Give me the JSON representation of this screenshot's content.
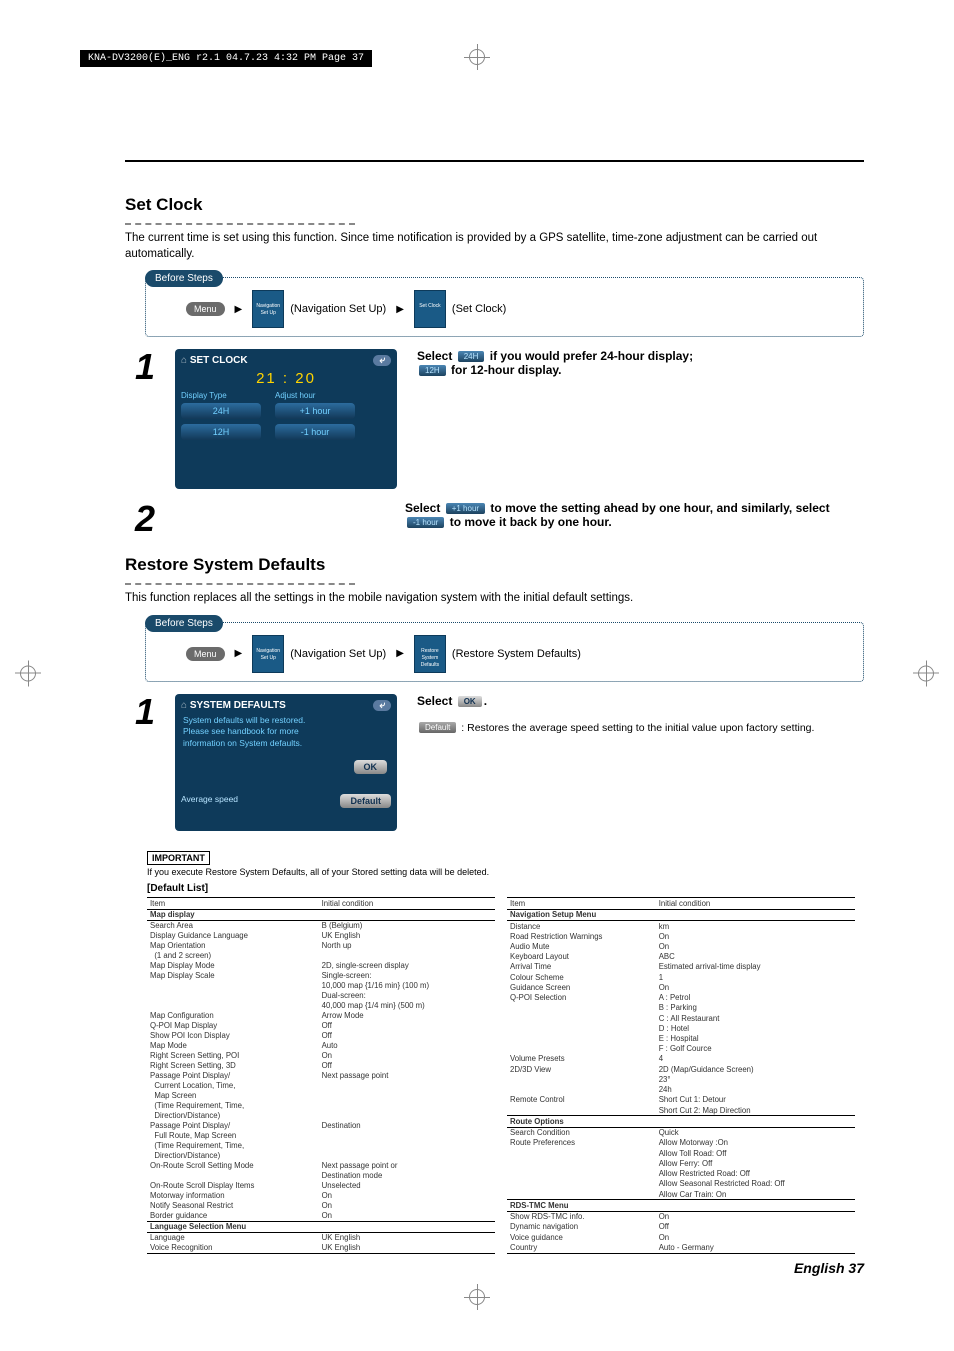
{
  "print": {
    "header": "KNA-DV3200(E)_ENG r2.1  04.7.23  4:32 PM  Page 37"
  },
  "section1": {
    "title": "Set Clock",
    "desc": "The current time is set using this function. Since time notification is provided by a GPS satellite, time-zone adjustment can be carried out automatically.",
    "before_steps": "Before Steps",
    "crumb_menu": "Menu",
    "crumb_nav": "(Navigation Set Up)",
    "crumb_setclock": "(Set Clock)",
    "nav_tile": "Navigation Set Up",
    "setclock_tile": "Set Clock",
    "screen": {
      "title": "SET CLOCK",
      "time": "21 : 20",
      "col1_label": "Display Type",
      "col2_label": "Adjust hour",
      "btn_24h": "24H",
      "btn_12h": "12H",
      "btn_plus": "+1 hour",
      "btn_minus": "-1 hour"
    },
    "step1": {
      "pre": "Select",
      "mid": "if you would prefer 24-hour display;",
      "post": "for 12-hour display.",
      "btn24": "24H",
      "btn12": "12H"
    },
    "step2": {
      "pre": "Select",
      "mid": "to move the setting ahead by one hour, and similarly, select",
      "post": "to move it back by one hour.",
      "btn_plus": "+1 hour",
      "btn_minus": "-1 hour"
    }
  },
  "section2": {
    "title": "Restore System Defaults",
    "desc": "This function replaces all the settings in the mobile navigation system with the initial default settings.",
    "before_steps": "Before Steps",
    "crumb_menu": "Menu",
    "crumb_nav": "(Navigation Set Up)",
    "crumb_rsd": "(Restore System Defaults)",
    "nav_tile": "Navigation Set Up",
    "rsd_tile": "Restore System Defaults",
    "screen": {
      "title": "SYSTEM DEFAULTS",
      "body1": "System defaults will be restored.",
      "body2": "Please see handbook for more",
      "body3": "information on System defaults.",
      "ok": "OK",
      "avg": "Average speed",
      "default": "Default"
    },
    "step": {
      "select": "Select",
      "ok": "OK",
      "default_label": "Default",
      "default_desc": ": Restores the average speed setting to the initial value upon factory setting."
    },
    "important_label": "IMPORTANT",
    "important_text": "If you execute Restore System Defaults, all of your Stored setting data will be deleted.",
    "deflist_header": "[Default List]",
    "tbl_item": "Item",
    "tbl_initial": "Initial condition",
    "tableA": {
      "sec1": "Map display",
      "rows1": [
        [
          "Search Area",
          "B (Belgium)"
        ],
        [
          "Display Guidance Language",
          "UK English"
        ],
        [
          "Map Orientation",
          "North up"
        ],
        [
          "  (1 and 2 screen)",
          ""
        ],
        [
          "Map Display Mode",
          "2D, single-screen display"
        ],
        [
          "Map Display Scale",
          "Single-screen:"
        ],
        [
          "",
          "10,000 map {1/16 min} (100 m)"
        ],
        [
          "",
          "Dual-screen:"
        ],
        [
          "",
          "40,000 map {1/4 min} (500 m)"
        ],
        [
          "Map Configuration",
          "Arrow Mode"
        ],
        [
          "Q-POI Map Display",
          "Off"
        ],
        [
          "Show POI Icon Display",
          "Off"
        ],
        [
          "Map Mode",
          "Auto"
        ],
        [
          "Right Screen Setting, POI",
          "On"
        ],
        [
          "Right Screen Setting, 3D",
          "Off"
        ],
        [
          "Passage Point Display/",
          "Next passage point"
        ],
        [
          "  Current Location, Time,",
          ""
        ],
        [
          "  Map Screen",
          ""
        ],
        [
          "  (Time Requirement, Time,",
          ""
        ],
        [
          "  Direction/Distance)",
          ""
        ],
        [
          "Passage Point Display/",
          "Destination"
        ],
        [
          "  Full Route, Map Screen",
          ""
        ],
        [
          "  (Time Requirement, Time,",
          ""
        ],
        [
          "  Direction/Distance)",
          ""
        ],
        [
          "On-Route Scroll Setting Mode",
          "Next passage point or"
        ],
        [
          "",
          "Destination mode"
        ],
        [
          "On-Route Scroll Display Items",
          "Unselected"
        ],
        [
          "Motorway information",
          "On"
        ],
        [
          "Notify Seasonal Restrict",
          "On"
        ],
        [
          "Border guidance",
          "On"
        ]
      ],
      "sec2": "Language Selection Menu",
      "rows2": [
        [
          "Language",
          "UK English"
        ],
        [
          "Voice Recognition",
          "UK English"
        ]
      ]
    },
    "tableB": {
      "sec1": "Navigation Setup Menu",
      "rows1": [
        [
          "Distance",
          "km"
        ],
        [
          "Road Restriction Warnings",
          "On"
        ],
        [
          "Audio Mute",
          "On"
        ],
        [
          "Keyboard Layout",
          "ABC"
        ],
        [
          "Arrival Time",
          "Estimated arrival-time display"
        ],
        [
          "Colour Scheme",
          "1"
        ],
        [
          "Guidance Screen",
          "On"
        ],
        [
          "Q-POI Selection",
          "A : Petrol"
        ],
        [
          "",
          "B : Parking"
        ],
        [
          "",
          "C : All Restaurant"
        ],
        [
          "",
          "D : Hotel"
        ],
        [
          "",
          "E : Hospital"
        ],
        [
          "",
          "F : Golf Cource"
        ],
        [
          "Volume Presets",
          "4"
        ],
        [
          "2D/3D View",
          "2D (Map/Guidance Screen)"
        ],
        [
          "",
          "23°"
        ],
        [
          "",
          "24h"
        ],
        [
          "Remote Control",
          "Short Cut 1: Detour"
        ],
        [
          "",
          "Short Cut 2: Map Direction"
        ]
      ],
      "sec2": "Route Options",
      "rows2": [
        [
          "Search Condition",
          "Quick"
        ],
        [
          "Route Preferences",
          "Allow Motorway :On"
        ],
        [
          "",
          "Allow Toll Road: Off"
        ],
        [
          "",
          "Allow Ferry: Off"
        ],
        [
          "",
          "Allow Restricted Road: Off"
        ],
        [
          "",
          "Allow Seasonal Restricted Road: Off"
        ],
        [
          "",
          "Allow Car Train: On"
        ]
      ],
      "sec3": "RDS-TMC Menu",
      "rows3": [
        [
          "Show RDS-TMC info.",
          "On"
        ],
        [
          "Dynamic navigation",
          "Off"
        ],
        [
          "Voice guidance",
          "On"
        ],
        [
          "Country",
          "Auto - Germany"
        ]
      ]
    }
  },
  "footer": "English 37"
}
